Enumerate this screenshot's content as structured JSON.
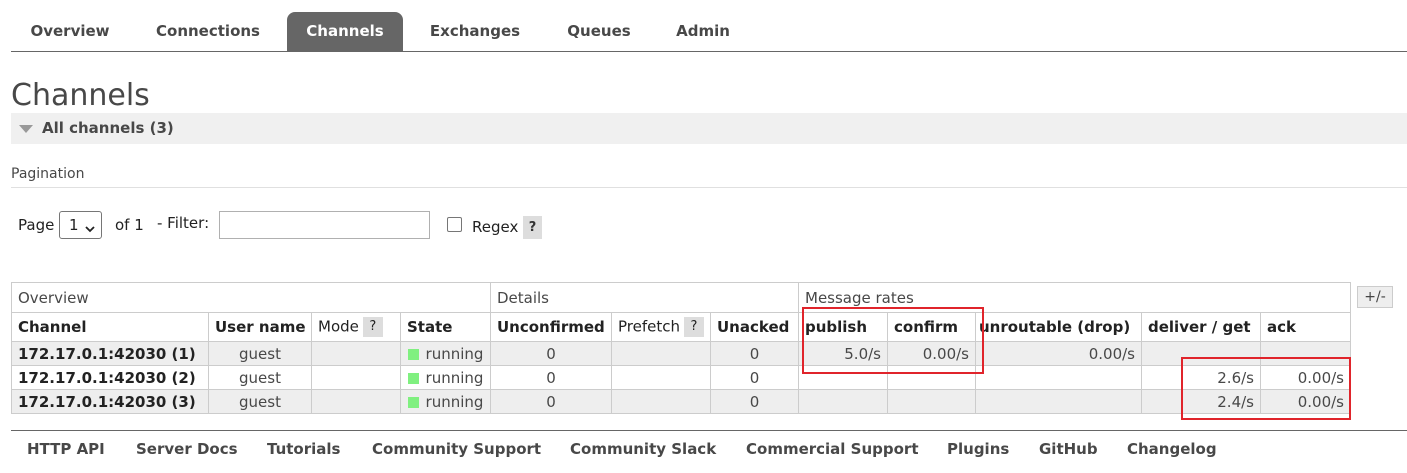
{
  "nav": {
    "tabs": [
      "Overview",
      "Connections",
      "Channels",
      "Exchanges",
      "Queues",
      "Admin"
    ],
    "active": "Channels"
  },
  "page": {
    "title": "Channels",
    "section_label": "All channels (3)"
  },
  "pagination": {
    "label": "Pagination",
    "page_label": "Page",
    "page_value": "1",
    "of_label": "of 1",
    "filter_label": "- Filter:",
    "filter_value": "",
    "regex_label": "Regex",
    "regex_checked": false,
    "help": "?"
  },
  "table": {
    "groups": [
      "Overview",
      "Details",
      "Message rates"
    ],
    "columns": {
      "channel": "Channel",
      "user": "User name",
      "mode": "Mode",
      "state": "State",
      "unconfirmed": "Unconfirmed",
      "prefetch": "Prefetch",
      "unacked": "Unacked",
      "publish": "publish",
      "confirm": "confirm",
      "unroutable": "unroutable (drop)",
      "deliver": "deliver / get",
      "ack": "ack"
    },
    "help": "?",
    "toggle": "+/-",
    "rows": [
      {
        "channel": "172.17.0.1:42030 (1)",
        "user": "guest",
        "mode": "",
        "state": "running",
        "unconfirmed": "0",
        "prefetch": "",
        "unacked": "0",
        "publish": "5.0/s",
        "confirm": "0.00/s",
        "unroutable": "0.00/s",
        "deliver": "",
        "ack": ""
      },
      {
        "channel": "172.17.0.1:42030 (2)",
        "user": "guest",
        "mode": "",
        "state": "running",
        "unconfirmed": "0",
        "prefetch": "",
        "unacked": "0",
        "publish": "",
        "confirm": "",
        "unroutable": "",
        "deliver": "2.6/s",
        "ack": "0.00/s"
      },
      {
        "channel": "172.17.0.1:42030 (3)",
        "user": "guest",
        "mode": "",
        "state": "running",
        "unconfirmed": "0",
        "prefetch": "",
        "unacked": "0",
        "publish": "",
        "confirm": "",
        "unroutable": "",
        "deliver": "2.4/s",
        "ack": "0.00/s"
      }
    ]
  },
  "footer": {
    "links": [
      "HTTP API",
      "Server Docs",
      "Tutorials",
      "Community Support",
      "Community Slack",
      "Commercial Support",
      "Plugins",
      "GitHub",
      "Changelog"
    ]
  },
  "colors": {
    "accent": "#666666",
    "running": "#80f080",
    "highlight": "#e0242b"
  }
}
